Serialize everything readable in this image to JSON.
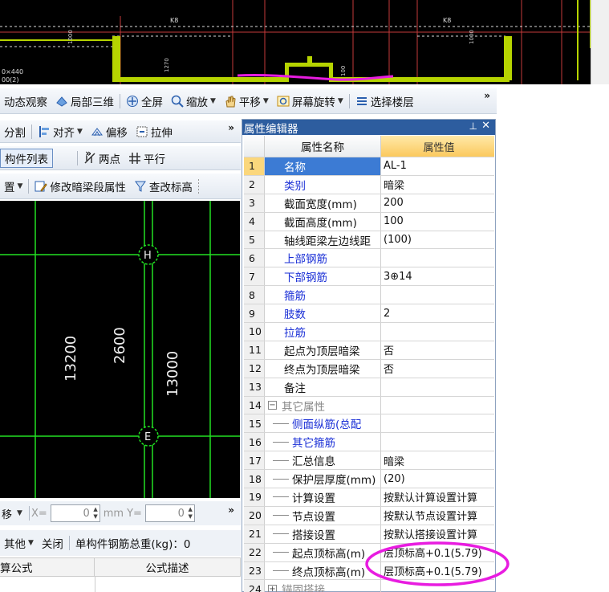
{
  "cad_top": {
    "label_left": "K8",
    "label_right": "K8",
    "dim_a": "1000",
    "dim_b": "1000",
    "dim_c": "1270",
    "dim_d": "100",
    "corner_text_1": "0×440",
    "corner_text_2": "00(2)"
  },
  "toolbar1": {
    "dynamic_view": "动态观察",
    "local_3d": "局部三维",
    "fullscreen": "全屏",
    "zoom": "缩放",
    "pan": "平移",
    "screen_rotate": "屏幕旋转",
    "select_floor": "选择楼层"
  },
  "toolbar2": {
    "split": "分割",
    "align": "对齐",
    "offset": "偏移",
    "stretch": "拉伸"
  },
  "toolbar3": {
    "component_list": "构件列表",
    "two_points": "两点",
    "parallel": "平行"
  },
  "toolbar4": {
    "set": "置",
    "modify_hidden_beam": "修改暗梁段属性",
    "check_elevation": "查改标高"
  },
  "canvas": {
    "dim_13200": "13200",
    "dim_2600": "2600",
    "dim_13000": "13000",
    "axis_h": "H",
    "axis_e": "E"
  },
  "coord_bar": {
    "move": "移",
    "x_label": "X=",
    "x_value": "0",
    "mm": "mm",
    "y_label": "Y=",
    "y_value": "0"
  },
  "opt_bar": {
    "other": "其他",
    "close": "关闭",
    "total_weight": "单构件钢筋总重(kg)：0"
  },
  "formula_table": {
    "col1": "算公式",
    "col2": "公式描述"
  },
  "property_editor": {
    "title": "属性编辑器",
    "pin": "ⅎ",
    "close": "✕",
    "head_name": "属性名称",
    "head_value": "属性值",
    "rows": [
      {
        "idx": "1",
        "name": "名称",
        "value": "AL-1"
      },
      {
        "idx": "2",
        "name": "类别",
        "value": "暗梁"
      },
      {
        "idx": "3",
        "name": "截面宽度(mm)",
        "value": "200"
      },
      {
        "idx": "4",
        "name": "截面高度(mm)",
        "value": "100"
      },
      {
        "idx": "5",
        "name": "轴线距梁左边线距",
        "value": "(100)"
      },
      {
        "idx": "6",
        "name": "上部钢筋",
        "value": ""
      },
      {
        "idx": "7",
        "name": "下部钢筋",
        "value": "3⊕14"
      },
      {
        "idx": "8",
        "name": "箍筋",
        "value": ""
      },
      {
        "idx": "9",
        "name": "肢数",
        "value": "2"
      },
      {
        "idx": "10",
        "name": "拉筋",
        "value": ""
      },
      {
        "idx": "11",
        "name": "起点为顶层暗梁",
        "value": "否"
      },
      {
        "idx": "12",
        "name": "终点为顶层暗梁",
        "value": "否"
      },
      {
        "idx": "13",
        "name": "备注",
        "value": ""
      },
      {
        "idx": "14",
        "name": "其它属性",
        "value": ""
      },
      {
        "idx": "15",
        "name": "侧面纵筋(总配",
        "value": ""
      },
      {
        "idx": "16",
        "name": "其它箍筋",
        "value": ""
      },
      {
        "idx": "17",
        "name": "汇总信息",
        "value": "暗梁"
      },
      {
        "idx": "18",
        "name": "保护层厚度(mm)",
        "value": "(20)"
      },
      {
        "idx": "19",
        "name": "计算设置",
        "value": "按默认计算设置计算"
      },
      {
        "idx": "20",
        "name": "节点设置",
        "value": "按默认节点设置计算"
      },
      {
        "idx": "21",
        "name": "搭接设置",
        "value": "按默认搭接设置计算"
      },
      {
        "idx": "22",
        "name": "起点顶标高(m)",
        "value": "层顶标高+0.1(5.79)"
      },
      {
        "idx": "23",
        "name": "终点顶标高(m)",
        "value": "层顶标高+0.1(5.79)"
      },
      {
        "idx": "24",
        "name": "锚固搭接",
        "value": ""
      }
    ]
  },
  "colors": {
    "accent_blue": "#2d5d9f",
    "magenta": "#e81ce0",
    "cad_green": "#22e022",
    "cad_yellow": "#b6d400"
  }
}
